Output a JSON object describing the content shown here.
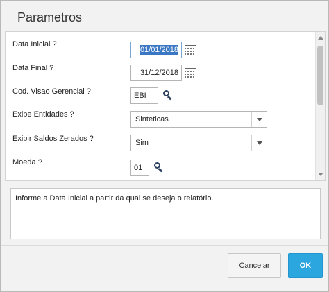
{
  "dialog": {
    "title": "Parametros"
  },
  "params": {
    "data_inicial": {
      "label": "Data Inicial ?",
      "value": "01/01/2018"
    },
    "data_final": {
      "label": "Data Final ?",
      "value": "31/12/2018"
    },
    "cod_visao": {
      "label": "Cod. Visao Gerencial ?",
      "value": "EBI"
    },
    "exibe_entidades": {
      "label": "Exibe Entidades ?",
      "value": "Sinteticas"
    },
    "exibir_saldos": {
      "label": "Exibir Saldos Zerados ?",
      "value": "Sim"
    },
    "moeda": {
      "label": "Moeda ?",
      "value": "01"
    }
  },
  "help": {
    "text": "Informe a Data Inicial a partir da qual se deseja o relatório."
  },
  "buttons": {
    "cancel": "Cancelar",
    "ok": "OK"
  },
  "icons": {
    "calendar": "calendar-icon",
    "search": "search-icon",
    "dropdown": "chevron-down-icon"
  },
  "colors": {
    "ok_button": "#2ba6de",
    "selection": "#3b78c4"
  }
}
